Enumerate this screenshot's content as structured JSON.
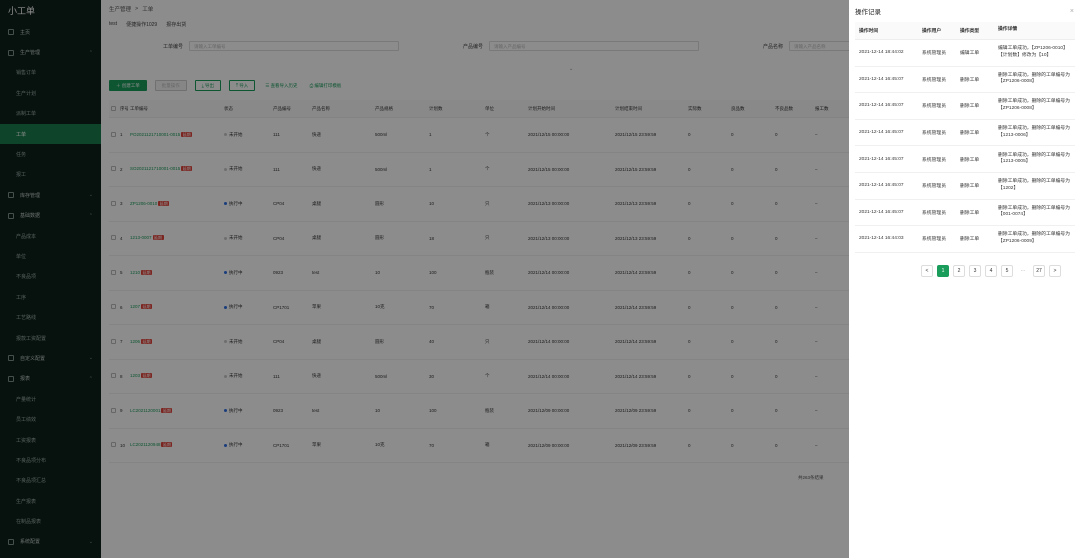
{
  "app_title": "小工单",
  "sidebar": {
    "items": [
      {
        "label": "主页",
        "type": "group",
        "icon": "home-icon"
      },
      {
        "label": "生产管理",
        "type": "group",
        "icon": "factory-icon",
        "chev": "⌃"
      },
      {
        "label": "销售订单",
        "type": "item"
      },
      {
        "label": "生产计划",
        "type": "item"
      },
      {
        "label": "派制工单",
        "type": "item"
      },
      {
        "label": "工单",
        "type": "item",
        "active": true
      },
      {
        "label": "任务",
        "type": "item"
      },
      {
        "label": "报工",
        "type": "item"
      },
      {
        "label": "库存管理",
        "type": "group",
        "icon": "box-icon",
        "chev": "⌄"
      },
      {
        "label": "基础数据",
        "type": "group",
        "icon": "database-icon",
        "chev": "⌃"
      },
      {
        "label": "产品成本",
        "type": "item"
      },
      {
        "label": "单位",
        "type": "item"
      },
      {
        "label": "不良品项",
        "type": "item"
      },
      {
        "label": "工序",
        "type": "item"
      },
      {
        "label": "工艺路线",
        "type": "item"
      },
      {
        "label": "报款工资配置",
        "type": "item"
      },
      {
        "label": "自定义配置",
        "type": "group",
        "icon": "settings-icon",
        "chev": "⌄"
      },
      {
        "label": "报表",
        "type": "group",
        "icon": "chart-icon",
        "chev": "⌃"
      },
      {
        "label": "产量统计",
        "type": "item"
      },
      {
        "label": "员工绩效",
        "type": "item"
      },
      {
        "label": "工资报表",
        "type": "item"
      },
      {
        "label": "不良品项分布",
        "type": "item"
      },
      {
        "label": "不良品项汇总",
        "type": "item"
      },
      {
        "label": "生产报表",
        "type": "item"
      },
      {
        "label": "在制品报表",
        "type": "item"
      },
      {
        "label": "系统配置",
        "type": "group",
        "icon": "system-icon",
        "chev": "⌄"
      }
    ]
  },
  "breadcrumb": {
    "parent": "生产管理",
    "sep": ">",
    "current": "工单"
  },
  "tabs": [
    "test",
    "便捷操作1029",
    "报存出货"
  ],
  "filters": [
    {
      "label": "工单编号",
      "placeholder": "请输入工单编号"
    },
    {
      "label": "产品编号",
      "placeholder": "请输入产品编号"
    },
    {
      "label": "产品名称",
      "placeholder": "请输入产品名称"
    }
  ],
  "expand_glyph": "⌄",
  "toolbar": {
    "create": "创建工单",
    "batch": "批量操作",
    "export": "导出",
    "import": "导入",
    "view": "查看导入历史",
    "print": "编辑打印模板"
  },
  "table": {
    "headers": [
      "序号",
      "工单编号",
      "状态",
      "产品编号",
      "产品名称",
      "产品规格",
      "计划数",
      "单位",
      "计划开始时间",
      "计划结束时间",
      "实际数",
      "良品数",
      "不良品数",
      "报工数"
    ],
    "rows": [
      {
        "no": "1",
        "code": "PO2021121710001-0015",
        "tag": "延期",
        "status": "未开始",
        "st": "idle",
        "pcode": "111",
        "pname": "快递",
        "spec": "500ml",
        "qty": "1",
        "unit": "个",
        "start": "2021/12/15 00:00:00",
        "end": "2021/12/15 23:59:59",
        "a": "0",
        "b": "0",
        "c": "0",
        "d": "–"
      },
      {
        "no": "2",
        "code": "SO2021121710001-0015",
        "tag": "延期",
        "status": "未开始",
        "st": "idle",
        "pcode": "111",
        "pname": "快递",
        "spec": "500ml",
        "qty": "1",
        "unit": "个",
        "start": "2021/12/15 00:00:00",
        "end": "2021/12/15 23:59:59",
        "a": "0",
        "b": "0",
        "c": "0",
        "d": "–"
      },
      {
        "no": "3",
        "code": "ZP1206-0010",
        "tag": "延期",
        "status": "执行中",
        "st": "run",
        "pcode": "CP04",
        "pname": "桌腿",
        "spec": "圆形",
        "qty": "10",
        "unit": "只",
        "start": "2021/12/13 00:00:00",
        "end": "2021/12/13 23:59:59",
        "a": "0",
        "b": "0",
        "c": "0",
        "d": "–"
      },
      {
        "no": "4",
        "code": "1213-0007",
        "tag": "延期",
        "status": "未开始",
        "st": "idle",
        "pcode": "CP04",
        "pname": "桌腿",
        "spec": "圆形",
        "qty": "18",
        "unit": "只",
        "start": "2021/12/13 00:00:00",
        "end": "2021/12/13 23:59:59",
        "a": "0",
        "b": "0",
        "c": "0",
        "d": "–"
      },
      {
        "no": "5",
        "code": "1210",
        "tag": "延期",
        "status": "执行中",
        "st": "run",
        "pcode": "0923",
        "pname": "test",
        "spec": "10",
        "qty": "100",
        "unit": "瓶装",
        "start": "2021/12/14 00:00:00",
        "end": "2021/12/14 23:59:59",
        "a": "0",
        "b": "0",
        "c": "0",
        "d": "–"
      },
      {
        "no": "6",
        "code": "1207",
        "tag": "延期",
        "status": "执行中",
        "st": "run",
        "pcode": "CP1701",
        "pname": "苹果",
        "spec": "10克",
        "qty": "70",
        "unit": "箱",
        "start": "2021/12/14 00:00:00",
        "end": "2021/12/14 23:59:59",
        "a": "0",
        "b": "0",
        "c": "0",
        "d": "–"
      },
      {
        "no": "7",
        "code": "1206",
        "tag": "延期",
        "status": "未开始",
        "st": "idle",
        "pcode": "CP04",
        "pname": "桌腿",
        "spec": "圆形",
        "qty": "40",
        "unit": "只",
        "start": "2021/12/14 00:00:00",
        "end": "2021/12/14 23:59:59",
        "a": "0",
        "b": "0",
        "c": "0",
        "d": "–"
      },
      {
        "no": "8",
        "code": "1203",
        "tag": "延期",
        "status": "未开始",
        "st": "idle",
        "pcode": "111",
        "pname": "快递",
        "spec": "500ml",
        "qty": "30",
        "unit": "个",
        "start": "2021/12/14 00:00:00",
        "end": "2021/12/14 23:59:59",
        "a": "0",
        "b": "0",
        "c": "0",
        "d": "–"
      },
      {
        "no": "9",
        "code": "LC2021120001",
        "tag": "延期",
        "status": "执行中",
        "st": "run",
        "pcode": "0923",
        "pname": "test",
        "spec": "10",
        "qty": "100",
        "unit": "瓶装",
        "start": "2021/12/09 00:00:00",
        "end": "2021/12/09 23:59:59",
        "a": "0",
        "b": "0",
        "c": "0",
        "d": "–"
      },
      {
        "no": "10",
        "code": "LC2021120948",
        "tag": "延期",
        "status": "执行中",
        "st": "run",
        "pcode": "CP1701",
        "pname": "苹果",
        "spec": "10克",
        "qty": "70",
        "unit": "箱",
        "start": "2021/12/09 00:00:00",
        "end": "2021/12/09 23:59:59",
        "a": "0",
        "b": "0",
        "c": "0",
        "d": "–"
      }
    ]
  },
  "main_pager": {
    "total": "共263条结果"
  },
  "drawer": {
    "title": "操作记录",
    "close": "×",
    "headers": [
      "操作时间",
      "操作用户",
      "操作类型",
      "操作详情"
    ],
    "rows": [
      {
        "time": "2021-12-14 18:44:02",
        "user": "系统管理员",
        "type": "编辑工单",
        "detail": "编辑工单成功，【ZP1206-0010】【计划数】修改为【10】"
      },
      {
        "time": "2021-12-14 16:45:07",
        "user": "系统管理员",
        "type": "删除工单",
        "detail": "删除工单成功，删除的工单编号为【ZP1206-0008】"
      },
      {
        "time": "2021-12-14 16:45:07",
        "user": "系统管理员",
        "type": "删除工单",
        "detail": "删除工单成功，删除的工单编号为【ZP1206-0008】"
      },
      {
        "time": "2021-12-14 16:45:07",
        "user": "系统管理员",
        "type": "删除工单",
        "detail": "删除工单成功，删除的工单编号为【1213-0006】"
      },
      {
        "time": "2021-12-14 16:45:07",
        "user": "系统管理员",
        "type": "删除工单",
        "detail": "删除工单成功，删除的工单编号为【1213-0005】"
      },
      {
        "time": "2021-12-14 16:45:07",
        "user": "系统管理员",
        "type": "删除工单",
        "detail": "删除工单成功，删除的工单编号为【1202】"
      },
      {
        "time": "2021-12-14 16:45:07",
        "user": "系统管理员",
        "type": "删除工单",
        "detail": "删除工单成功，删除的工单编号为【001-0074】"
      },
      {
        "time": "2021-12-14 16:44:03",
        "user": "系统管理员",
        "type": "删除工单",
        "detail": "删除工单成功，删除的工单编号为【ZP1206-0009】"
      }
    ],
    "pager": {
      "prev": "<",
      "pages": [
        "1",
        "2",
        "3",
        "4",
        "5"
      ],
      "ellipsis": "···",
      "last": "27",
      "next": ">",
      "active": "1"
    }
  }
}
